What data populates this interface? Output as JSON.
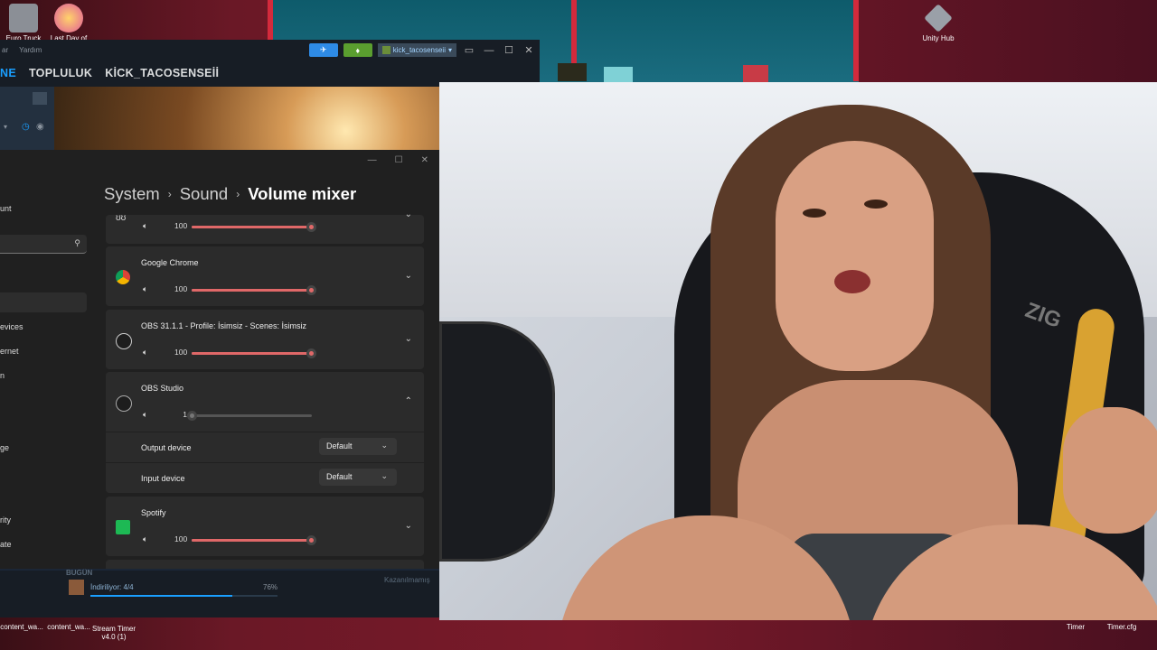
{
  "desktop": {
    "icons_top": [
      {
        "label": "Euro Truck",
        "color": "#8b8f96"
      },
      {
        "label": "Last Day of",
        "color": "#e0a84a"
      },
      {
        "label": "Unity Hub",
        "color": "#9aa0a8"
      }
    ],
    "icons_bottom": [
      {
        "label": "content_wa..."
      },
      {
        "label": "content_wa..."
      },
      {
        "label": "Stream Timer v4.0 (1)"
      },
      {
        "label": "Timer"
      },
      {
        "label": "Timer.cfg"
      }
    ]
  },
  "steam": {
    "menu": [
      "ar",
      "Yardım"
    ],
    "user": "kick_tacosenseii",
    "nav": [
      "NE",
      "TOPLULUK",
      "KİCK_TACOSENSEİİ"
    ],
    "section_label": "BUGÜN",
    "kazan_label": "Kazanılmamış",
    "download_text": "İndiriliyor: 4/4",
    "download_percent": "76%",
    "download_progress": 0.76
  },
  "settings": {
    "breadcrumb": [
      "System",
      "Sound",
      "Volume mixer"
    ],
    "sidebar_fragments": [
      "unt",
      "evices",
      "ernet",
      "n",
      "ge",
      "rity",
      "ate"
    ],
    "apps": [
      {
        "name": "",
        "volume": "100",
        "level": 1.0,
        "icon": "headphones-icon",
        "expanded": false
      },
      {
        "name": "Google Chrome",
        "volume": "100",
        "level": 1.0,
        "icon": "chrome-icon",
        "expanded": false
      },
      {
        "name": "OBS 31.1.1 - Profile: İsimsiz - Scenes: İsimsiz",
        "volume": "100",
        "level": 1.0,
        "icon": "obs-icon",
        "expanded": false
      },
      {
        "name": "OBS Studio",
        "volume": "1",
        "level": 0.01,
        "icon": "obs-icon",
        "expanded": true
      },
      {
        "name": "Spotify",
        "volume": "100",
        "level": 1.0,
        "icon": "spotify-icon",
        "expanded": false
      }
    ],
    "output_device_label": "Output device",
    "output_device_value": "Default",
    "input_device_label": "Input device",
    "input_device_value": "Default",
    "accent": "#e06868"
  },
  "webcam": {
    "chair_logo": "ZIG"
  }
}
